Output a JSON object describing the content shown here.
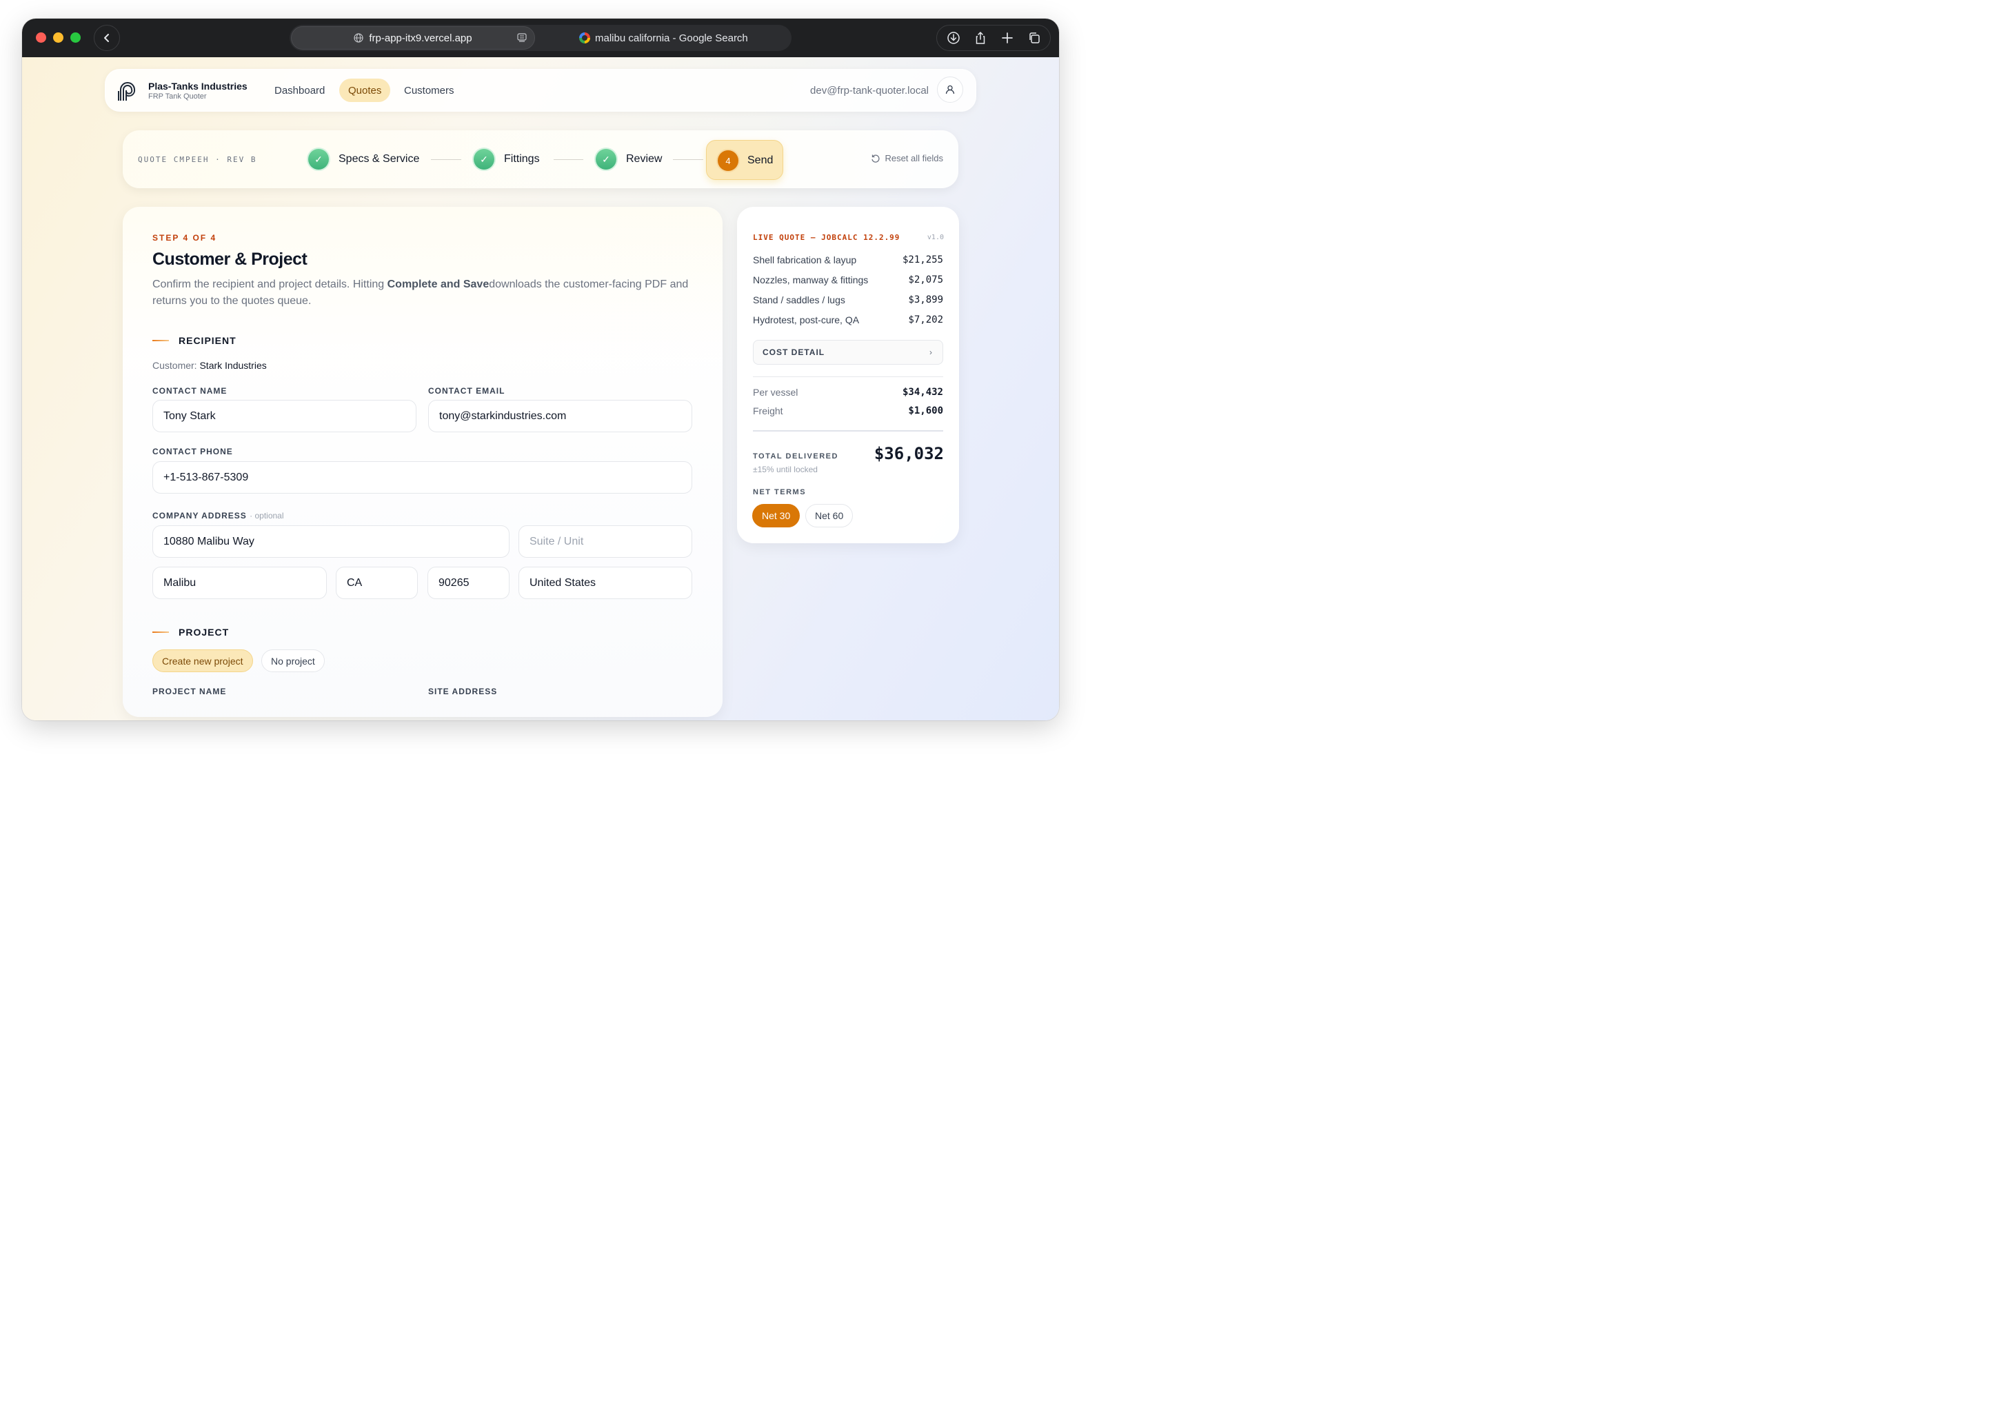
{
  "browser": {
    "active_tab_url": "frp-app-itx9.vercel.app",
    "inactive_tab_title": "malibu california - Google Search"
  },
  "nav": {
    "brand_name": "Plas-Tanks Industries",
    "brand_sub": "FRP Tank Quoter",
    "items": [
      {
        "label": "Dashboard"
      },
      {
        "label": "Quotes"
      },
      {
        "label": "Customers"
      }
    ],
    "user_email": "dev@frp-tank-quoter.local"
  },
  "stepper": {
    "quote_id": "QUOTE CMPEEH · REV B",
    "steps": [
      {
        "label": "Specs & Service",
        "status": "complete"
      },
      {
        "label": "Fittings",
        "status": "complete"
      },
      {
        "label": "Review",
        "status": "complete"
      },
      {
        "label": "Send",
        "status": "active",
        "number": "4"
      }
    ],
    "reset_label": "Reset all fields"
  },
  "form": {
    "eyebrow": "STEP 4 OF 4",
    "title": "Customer & Project",
    "desc_before": "Confirm the recipient and project details. Hitting ",
    "desc_bold": "Complete and Save",
    "desc_after": "downloads the customer-facing PDF and returns you to the quotes queue.",
    "recipient_heading": "RECIPIENT",
    "customer_label": "Customer:",
    "customer_value": "Stark Industries",
    "contact_name_label": "CONTACT NAME",
    "contact_name_value": "Tony Stark",
    "contact_email_label": "CONTACT EMAIL",
    "contact_email_value": "tony@starkindustries.com",
    "contact_phone_label": "CONTACT PHONE",
    "contact_phone_value": "+1-513-867-5309",
    "company_address_label": "COMPANY ADDRESS",
    "company_address_optional": "· optional",
    "street_value": "10880 Malibu Way",
    "suite_placeholder": "Suite / Unit",
    "city_value": "Malibu",
    "state_value": "CA",
    "zip_value": "90265",
    "country_value": "United States",
    "project_heading": "PROJECT",
    "project_options": [
      {
        "label": "Create new project",
        "selected": true
      },
      {
        "label": "No project",
        "selected": false
      }
    ],
    "project_name_label": "PROJECT NAME",
    "site_address_label": "SITE ADDRESS"
  },
  "quote": {
    "eyebrow": "LIVE QUOTE — JOBCALC 12.2.99",
    "version": "v1.0",
    "line_items": [
      {
        "label": "Shell fabrication & layup",
        "amount": "$21,255"
      },
      {
        "label": "Nozzles, manway & fittings",
        "amount": "$2,075"
      },
      {
        "label": "Stand / saddles / lugs",
        "amount": "$3,899"
      },
      {
        "label": "Hydrotest, post-cure, QA",
        "amount": "$7,202"
      }
    ],
    "cost_detail_label": "COST DETAIL",
    "per_vessel_label": "Per vessel",
    "per_vessel_amount": "$34,432",
    "freight_label": "Freight",
    "freight_amount": "$1,600",
    "total_label": "TOTAL DELIVERED",
    "total_note": "±15% until locked",
    "total_amount": "$36,032",
    "terms_label": "NET TERMS",
    "terms": [
      {
        "label": "Net 30",
        "selected": true
      },
      {
        "label": "Net 60",
        "selected": false
      }
    ]
  },
  "colors": {
    "accent": "#d97706",
    "accent_soft": "#fbe8b8",
    "success": "#3fb37a",
    "eyebrow": "#c2410c"
  }
}
